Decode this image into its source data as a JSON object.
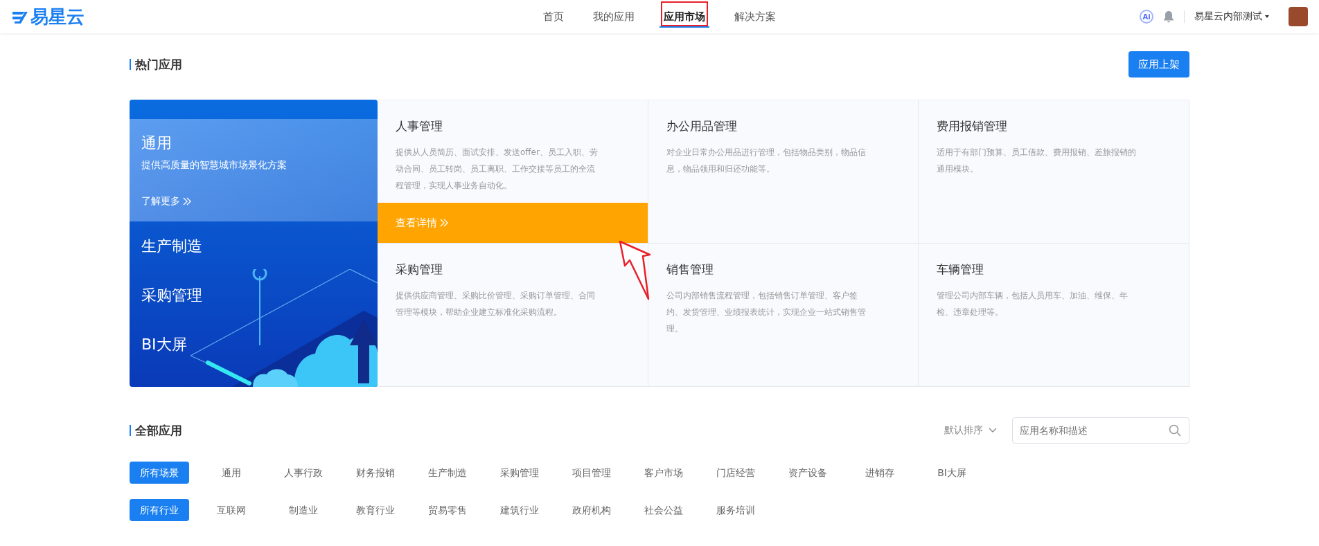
{
  "header": {
    "logo": "易星云",
    "nav": [
      {
        "label": "首页",
        "selected": false,
        "highlighted": false
      },
      {
        "label": "我的应用",
        "selected": false,
        "highlighted": false
      },
      {
        "label": "应用市场",
        "selected": true,
        "highlighted": true
      },
      {
        "label": "解决方案",
        "selected": false,
        "highlighted": false
      }
    ],
    "ai_badge": "Ai",
    "user": "易星云内部测试"
  },
  "hot": {
    "title": "热门应用",
    "publish_button": "应用上架",
    "categories": [
      {
        "name": "通用",
        "selected": true,
        "description": "提供高质量的智慧城市场景化方案",
        "more": "了解更多"
      },
      {
        "name": "生产制造",
        "selected": false
      },
      {
        "name": "采购管理",
        "selected": false
      },
      {
        "name": "BI大屏",
        "selected": false
      }
    ],
    "details_link": "查看详情",
    "apps": [
      {
        "title": "人事管理",
        "description": "提供从人员简历、面试安排、发送offer、员工入职、劳动合同、员工转岗、员工离职、工作交接等员工的全流程管理，实现人事业务自动化。",
        "active": true
      },
      {
        "title": "办公用品管理",
        "description": "对企业日常办公用品进行管理，包括物品类别，物品信息，物品领用和归还功能等。",
        "active": false
      },
      {
        "title": "费用报销管理",
        "description": "适用于有部门预算、员工借款、费用报销、差旅报销的通用模块。",
        "active": false
      },
      {
        "title": "采购管理",
        "description": "提供供应商管理、采购比价管理、采购订单管理、合同管理等模块，帮助企业建立标准化采购流程。",
        "active": false
      },
      {
        "title": "销售管理",
        "description": "公司内部销售流程管理，包括销售订单管理、客户签约、发货管理、业绩报表统计，实现企业一站式销售管理。",
        "active": false
      },
      {
        "title": "车辆管理",
        "description": "管理公司内部车辆，包括人员用车、加油、维保、年检、违章处理等。",
        "active": false
      }
    ]
  },
  "all": {
    "title": "全部应用",
    "sort": "默认排序",
    "search": {
      "placeholder": "应用名称和描述"
    },
    "scenes": [
      {
        "label": "所有场景",
        "selected": true
      },
      {
        "label": "通用",
        "selected": false
      },
      {
        "label": "人事行政",
        "selected": false
      },
      {
        "label": "财务报销",
        "selected": false
      },
      {
        "label": "生产制造",
        "selected": false
      },
      {
        "label": "采购管理",
        "selected": false
      },
      {
        "label": "项目管理",
        "selected": false
      },
      {
        "label": "客户市场",
        "selected": false
      },
      {
        "label": "门店经营",
        "selected": false
      },
      {
        "label": "资产设备",
        "selected": false
      },
      {
        "label": "进销存",
        "selected": false
      },
      {
        "label": "BI大屏",
        "selected": false
      }
    ],
    "industries": [
      {
        "label": "所有行业",
        "selected": true
      },
      {
        "label": "互联网",
        "selected": false
      },
      {
        "label": "制造业",
        "selected": false
      },
      {
        "label": "教育行业",
        "selected": false
      },
      {
        "label": "贸易零售",
        "selected": false
      },
      {
        "label": "建筑行业",
        "selected": false
      },
      {
        "label": "政府机构",
        "selected": false
      },
      {
        "label": "社会公益",
        "selected": false
      },
      {
        "label": "服务培训",
        "selected": false
      }
    ]
  }
}
